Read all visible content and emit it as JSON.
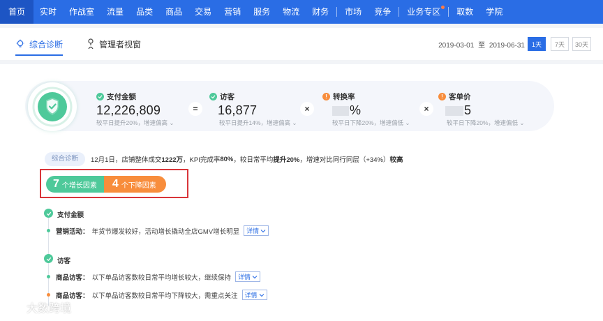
{
  "nav": {
    "items": [
      "首页",
      "实时",
      "作战室",
      "流量",
      "品类",
      "商品",
      "交易",
      "营销",
      "服务",
      "物流",
      "财务",
      "市场",
      "竞争",
      "业务专区",
      "取数",
      "学院"
    ]
  },
  "subnav": {
    "tab1": "综合诊断",
    "tab2": "管理者视窗",
    "date_start": "2019-03-01",
    "date_to": "至",
    "date_end": "2019-06-31",
    "ranges": [
      "1天",
      "7天",
      "30天"
    ]
  },
  "metrics": {
    "pay": {
      "label": "支付金额",
      "value": "12,226,809",
      "note": "较平日提升20%，增速偏高 ⌄"
    },
    "visitor": {
      "label": "访客",
      "value": "16,877",
      "note": "较平日提升14%，增速偏高 ⌄"
    },
    "conversion": {
      "label": "转换率",
      "value": "%",
      "note": "较平日下降20%，增速偏低 ⌄"
    },
    "unit_price": {
      "label": "客单价",
      "value": "5",
      "note": "较平日下降20%，增速偏低 ⌄"
    }
  },
  "ops": {
    "eq": "=",
    "times": "×"
  },
  "diagnosis": {
    "pill": "综合诊断",
    "p1": "12月1日，店铺整体成交",
    "b1": "1222万",
    "p2": "，KPI完成率",
    "b2": "80%",
    "p3": "，较日常平均",
    "b3": "提升20%",
    "p4": "，增速对比同行同层（+34%）",
    "b4": "较高"
  },
  "factors": {
    "up_num": "7",
    "up_label": "个增长因素",
    "down_num": "4",
    "down_label": "个下降因素"
  },
  "sections": {
    "pay_title": "支付金额",
    "pay_row_key": "营销活动：",
    "pay_row_text": "年货节爆发较好，活动增长撬动全店GMV增长明显",
    "visitor_title": "访客",
    "visitor_row1_key": "商品访客：",
    "visitor_row1_text": "以下单品访客数较日常平均增长较大，继续保持",
    "visitor_row2_key": "商品访客：",
    "visitor_row2_text": "以下单品访客数较日常平均下降较大，需重点关注",
    "detail": "详情"
  },
  "watermark": "大数跨境",
  "colors": {
    "brand": "#2a6de5",
    "green": "#4ec99a",
    "orange": "#f88d3c",
    "red_box": "#d9353a"
  }
}
